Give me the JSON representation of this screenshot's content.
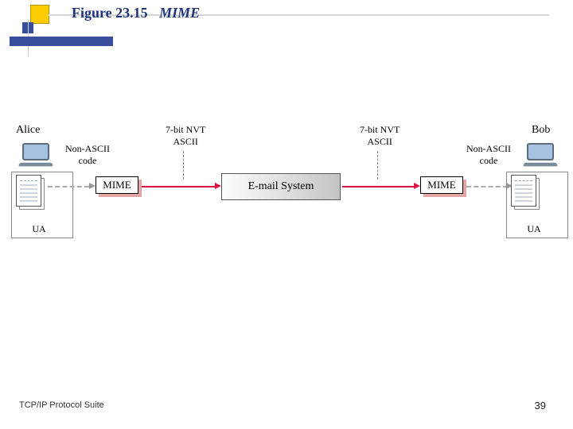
{
  "figure": {
    "number": "Figure 23.15",
    "caption": "MIME"
  },
  "footer": {
    "left": "TCP/IP Protocol Suite",
    "page": "39"
  },
  "diagram": {
    "users": {
      "left": "Alice",
      "right": "Bob"
    },
    "ua_left": "UA",
    "ua_right": "UA",
    "nonascii_left": "Non-ASCII\ncode",
    "nonascii_right": "Non-ASCII\ncode",
    "mime_left": "MIME",
    "mime_right": "MIME",
    "ascii_left": "7-bit NVT\nASCII",
    "ascii_right": "7-bit NVT\nASCII",
    "email_system": "E-mail System"
  }
}
